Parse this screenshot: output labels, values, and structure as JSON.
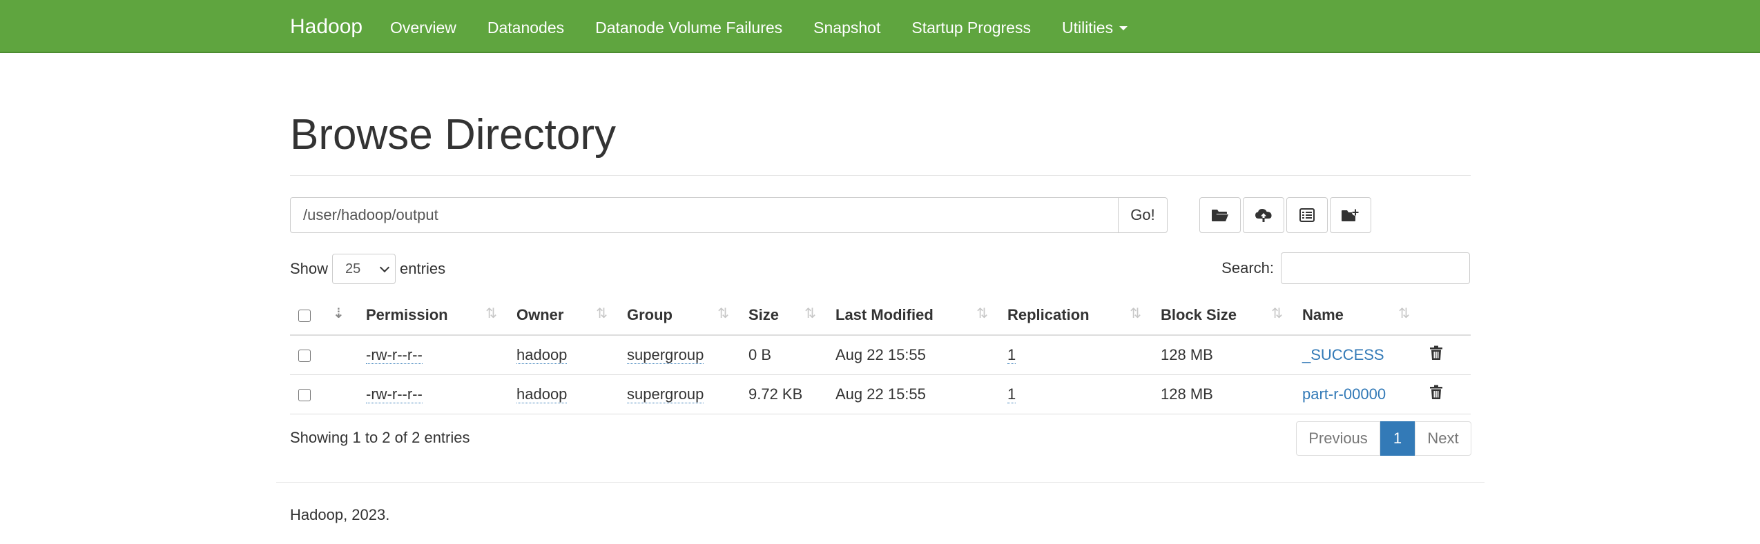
{
  "navbar": {
    "brand": "Hadoop",
    "items": [
      "Overview",
      "Datanodes",
      "Datanode Volume Failures",
      "Snapshot",
      "Startup Progress",
      "Utilities"
    ]
  },
  "page": {
    "title": "Browse Directory"
  },
  "path_bar": {
    "value": "/user/hadoop/output",
    "go_label": "Go!"
  },
  "toolbar_icons": [
    "folder-open-icon",
    "cloud-upload-icon",
    "list-alt-icon",
    "folder-add-icon"
  ],
  "entries": {
    "show_label": "Show",
    "selected": "25",
    "suffix": "entries"
  },
  "search": {
    "label": "Search:",
    "value": ""
  },
  "table": {
    "columns": [
      "Permission",
      "Owner",
      "Group",
      "Size",
      "Last Modified",
      "Replication",
      "Block Size",
      "Name"
    ],
    "rows": [
      {
        "permission": "-rw-r--r--",
        "owner": "hadoop",
        "group": "supergroup",
        "size": "0 B",
        "modified": "Aug 22 15:55",
        "replication": "1",
        "block_size": "128 MB",
        "name": "_SUCCESS"
      },
      {
        "permission": "-rw-r--r--",
        "owner": "hadoop",
        "group": "supergroup",
        "size": "9.72 KB",
        "modified": "Aug 22 15:55",
        "replication": "1",
        "block_size": "128 MB",
        "name": "part-r-00000"
      }
    ]
  },
  "showing_info": "Showing 1 to 2 of 2 entries",
  "pagination": {
    "previous": "Previous",
    "current": "1",
    "next": "Next"
  },
  "footer": {
    "text": "Hadoop, 2023."
  },
  "colors": {
    "navbar": "#5fa53f",
    "link": "#337ab7",
    "active_page": "#337ab7"
  }
}
